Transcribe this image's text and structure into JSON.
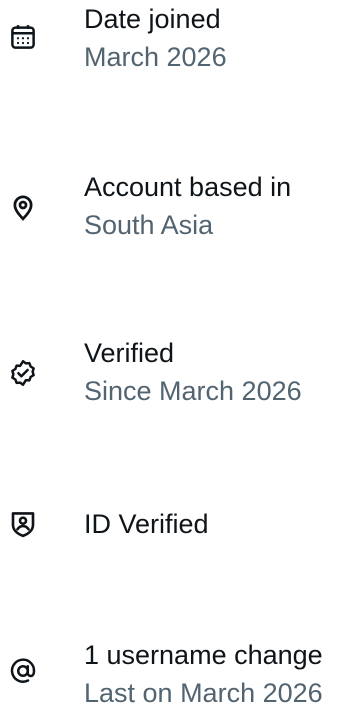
{
  "about_account": {
    "items": [
      {
        "icon": "calendar-icon",
        "title": "Date joined",
        "detail": "March 2026"
      },
      {
        "icon": "location-pin-icon",
        "title": "Account based in",
        "detail": "South Asia"
      },
      {
        "icon": "verified-badge-icon",
        "title": "Verified",
        "detail": "Since March 2026"
      },
      {
        "icon": "id-shield-icon",
        "title": "ID Verified",
        "detail": ""
      },
      {
        "icon": "at-sign-icon",
        "title": "1 username change",
        "detail": "Last on March 2026"
      }
    ]
  },
  "colors": {
    "primary_text": "#0f1419",
    "secondary_text": "#536471",
    "background": "#ffffff"
  }
}
